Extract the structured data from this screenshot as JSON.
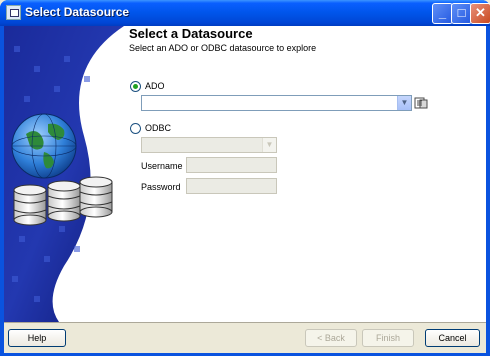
{
  "window": {
    "title": "Select Datasource",
    "controls": {
      "minimize": "_",
      "maximize": "□",
      "close": "✕"
    }
  },
  "header": {
    "title": "Select a Datasource",
    "subtitle": "Select an ADO or ODBC datasource to explore"
  },
  "ado": {
    "label": "ADO",
    "selected": true,
    "value": ""
  },
  "odbc": {
    "label": "ODBC",
    "selected": false,
    "value": "",
    "username_label": "Username",
    "username_value": "",
    "password_label": "Password",
    "password_value": ""
  },
  "footer": {
    "help": "Help",
    "back": "< Back",
    "finish": "Finish",
    "cancel": "Cancel"
  },
  "colors": {
    "titlebar": "#0055ea",
    "sidebar_dark": "#101a7a",
    "sidebar_light": "#3c56c8",
    "dialog_bg": "#ece9d8",
    "radio_dot": "#21a121"
  },
  "icons": {
    "sidebar_art": "globe-with-database-icon",
    "browse": "browse-datasource-icon"
  }
}
